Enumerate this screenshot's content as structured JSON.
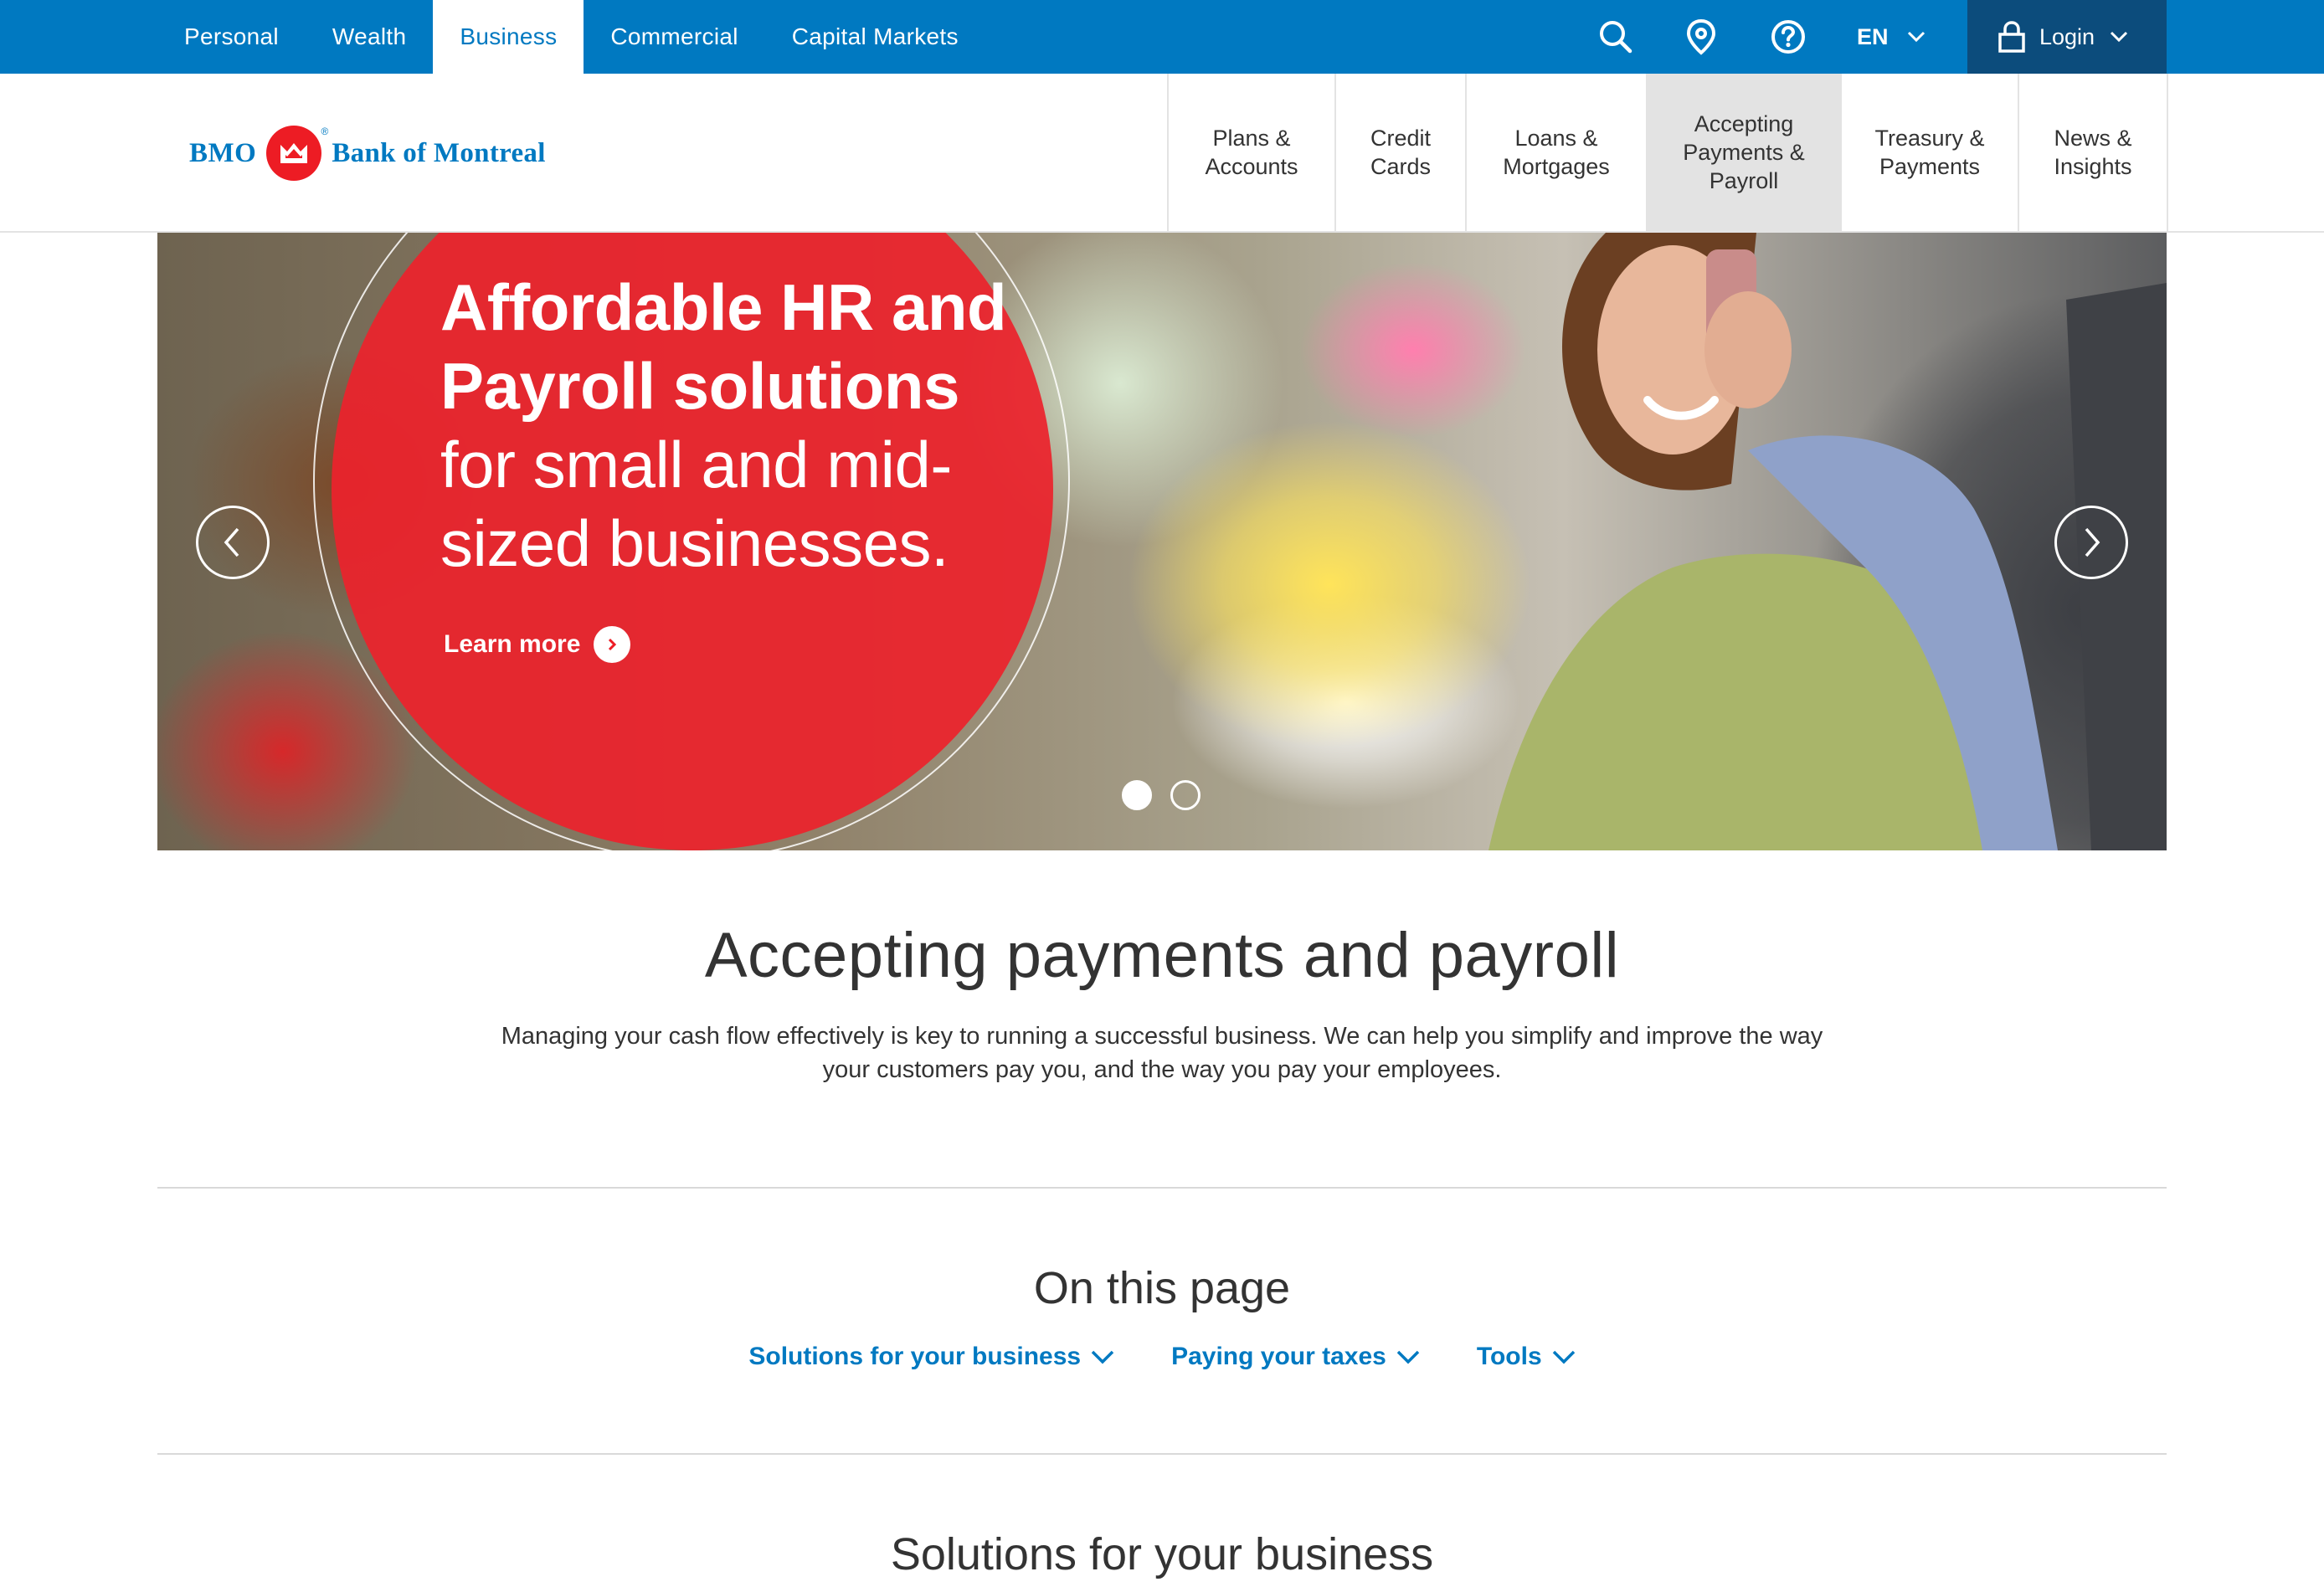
{
  "top_nav": {
    "tabs": [
      {
        "label": "Personal",
        "active": false
      },
      {
        "label": "Wealth",
        "active": false
      },
      {
        "label": "Business",
        "active": true
      },
      {
        "label": "Commercial",
        "active": false
      },
      {
        "label": "Capital Markets",
        "active": false
      }
    ],
    "icons": [
      "search-icon",
      "location-pin-icon",
      "help-icon"
    ],
    "language": "EN",
    "login_label": "Login"
  },
  "logo": {
    "brand": "BMO",
    "bank_name": "Bank of Montreal",
    "registered": "®"
  },
  "main_nav": {
    "items": [
      {
        "label": "Plans & Accounts",
        "active": false
      },
      {
        "label": "Credit Cards",
        "active": false
      },
      {
        "label": "Loans & Mortgages",
        "active": false
      },
      {
        "label": "Accepting Payments & Payroll",
        "active": true
      },
      {
        "label": "Treasury & Payments",
        "active": false
      },
      {
        "label": "News & Insights",
        "active": false
      }
    ]
  },
  "hero": {
    "headline_bold": "Affordable HR and Payroll solutions",
    "headline_rest": "for small and mid-sized businesses.",
    "cta_label": "Learn more",
    "slide_count": 2,
    "active_slide": 1
  },
  "page": {
    "title": "Accepting payments and payroll",
    "intro": "Managing your cash flow effectively is key to running a successful business. We can help you simplify and improve the way your customers pay you, and the way you pay your employees."
  },
  "on_this_page": {
    "heading": "On this page",
    "links": [
      "Solutions for your business",
      "Paying your taxes",
      "Tools"
    ]
  },
  "section": {
    "heading": "Solutions for your business"
  },
  "colors": {
    "brand_blue": "#0079c1",
    "login_navy": "#0c4c7c",
    "brand_red": "#ed1c24"
  }
}
